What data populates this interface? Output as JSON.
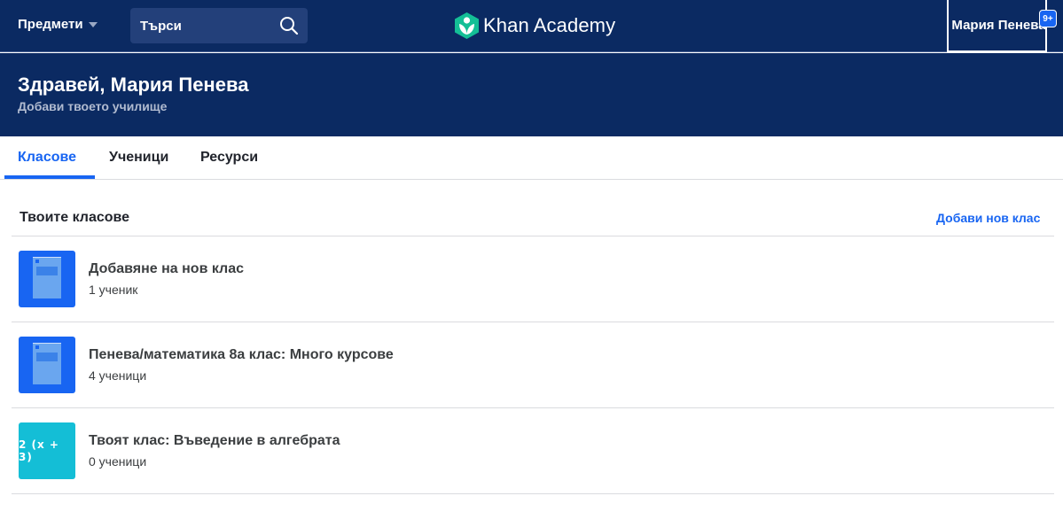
{
  "topbar": {
    "subjects_label": "Предмети",
    "search_placeholder": "Търси",
    "logo_text": "Khan Academy",
    "user_name": "Мария Пенева",
    "notifications_badge": "9+"
  },
  "greeting": {
    "title": "Здравей, Мария Пенева",
    "add_school": "Добави твоето училище"
  },
  "tabs": [
    {
      "label": "Класове",
      "active": true
    },
    {
      "label": "Ученици",
      "active": false
    },
    {
      "label": "Ресурси",
      "active": false
    }
  ],
  "classes_section": {
    "title": "Твоите класове",
    "add_class_label": "Добави нов клас",
    "items": [
      {
        "name": "Добавяне на нов клас",
        "students": "1 ученик",
        "icon": "book-icon"
      },
      {
        "name": "Пенева/математика 8а клас: Много курсове",
        "students": "4 ученици",
        "icon": "book-icon"
      },
      {
        "name": "Твоят клас: Въведение в алгебрата",
        "students": "0 ученици",
        "icon": "algebra-icon",
        "icon_text": "2 (x + 3)"
      }
    ]
  },
  "colors": {
    "header_bg": "#0b2a62",
    "accent": "#1865f2",
    "algebra_tile": "#14bed6"
  }
}
